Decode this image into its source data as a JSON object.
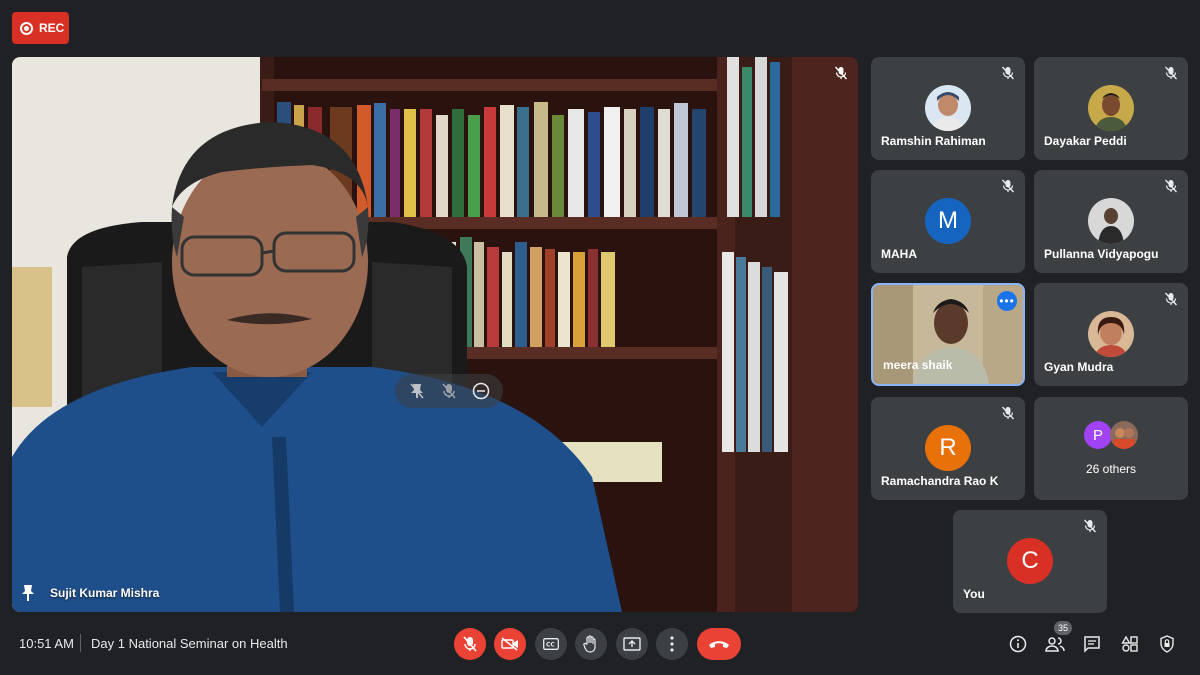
{
  "recording": {
    "label": "REC"
  },
  "main_speaker": {
    "name": "Sujit Kumar Mishra"
  },
  "participants": [
    {
      "name": "Ramshin Rahiman",
      "avatar_type": "photo",
      "muted": true
    },
    {
      "name": "Dayakar Peddi",
      "avatar_type": "photo",
      "muted": true
    },
    {
      "name": "MAHA",
      "avatar_type": "letter",
      "initial": "M",
      "color": "#1565c0",
      "muted": true
    },
    {
      "name": "Pullanna Vidyapogu",
      "avatar_type": "photo",
      "muted": true
    },
    {
      "name": "meera shaik",
      "avatar_type": "video",
      "active": true
    },
    {
      "name": "Gyan Mudra",
      "avatar_type": "photo",
      "muted": true
    },
    {
      "name": "Ramachandra Rao K",
      "avatar_type": "letter",
      "initial": "R",
      "color": "#e8710a",
      "muted": true
    },
    {
      "name": "26 others",
      "avatar_type": "group",
      "initial": "P",
      "color": "#a142f4"
    },
    {
      "name": "You",
      "avatar_type": "letter",
      "initial": "C",
      "color": "#d93025",
      "muted": true
    }
  ],
  "bottom_bar": {
    "time": "10:51 AM",
    "meeting_title": "Day 1 National Seminar on Health",
    "people_count": "35"
  },
  "colors": {
    "background": "#202124",
    "tile": "#3c4043",
    "danger": "#ea4335",
    "active_border": "#8ab4f8"
  }
}
